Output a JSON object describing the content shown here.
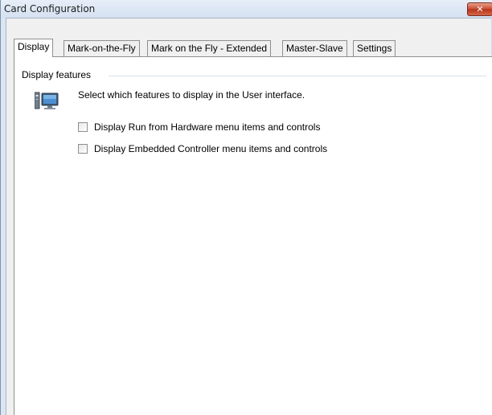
{
  "window": {
    "title": "Card Configuration",
    "close_label": "✕"
  },
  "tabs": [
    {
      "label": "Display",
      "active": true
    },
    {
      "label": "Mark-on-the-Fly",
      "active": false
    },
    {
      "label": "Mark on the Fly - Extended",
      "active": false
    },
    {
      "label": "Master-Slave",
      "active": false
    },
    {
      "label": "Settings",
      "active": false
    }
  ],
  "display": {
    "group_label": "Display features",
    "icon": "computer-icon",
    "description": "Select which features to display in the User interface.",
    "options": [
      {
        "label": "Display Run from Hardware menu items and controls",
        "checked": false
      },
      {
        "label": "Display Embedded Controller menu items and controls",
        "checked": false
      }
    ]
  }
}
